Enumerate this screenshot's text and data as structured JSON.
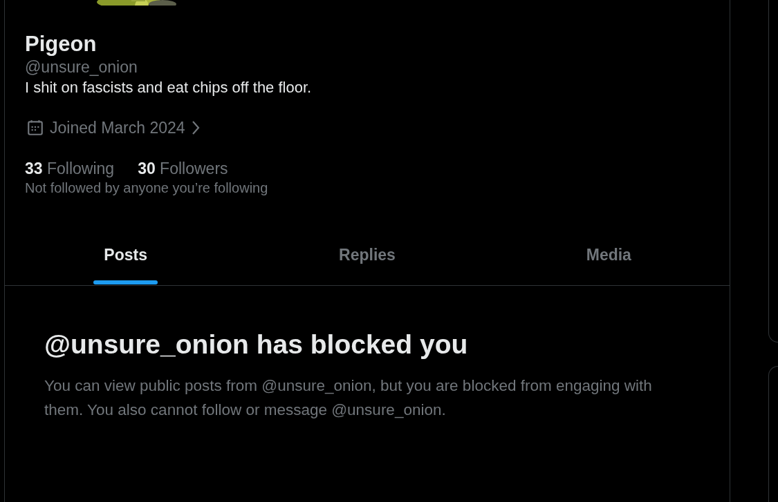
{
  "profile": {
    "name": "Pigeon",
    "handle": "@unsure_onion",
    "bio": "I shit on fascists and eat chips off the floor.",
    "joined": "Joined March 2024",
    "following": "**33** Following",
    "followers": "**30** Followers",
    "followed_by": "Not followed by anyone you’re following"
  },
  "tabs": [
    {
      "label": "Posts",
      "selected": true
    },
    {
      "label": "Replies",
      "selected": false
    },
    {
      "label": "Media",
      "selected": false
    }
  ],
  "blocked_notice": {
    "title": "@unsure_onion has blocked you",
    "body": "You can view public posts from @unsure_onion, but you are blocked from engaging with them. You also cannot follow or message @unsure_onion."
  }
}
